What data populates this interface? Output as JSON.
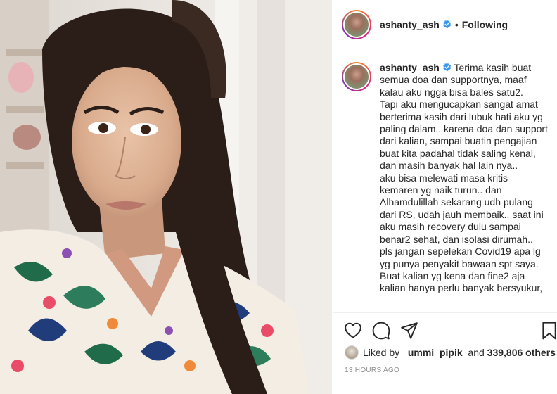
{
  "post": {
    "username": "ashanty_ash",
    "separator": "•",
    "follow_status": "Following",
    "caption_username": "ashanty_ash",
    "caption": " Terima kasih buat semua doa dan supportnya, maaf kalau aku ngga bisa bales satu2.\nTapi aku mengucapkan sangat amat berterima kasih dari lubuk hati aku yg paling dalam.. karena doa dan support dari kalian, sampai buatin pengajian buat kita padahal tidak saling kenal, dan masih banyak hal lain nya..\naku bisa melewati masa kritis kemaren yg naik turun.. dan Alhamdulillah sekarang udh pulang dari RS, udah jauh membaik.. saat ini aku masih recovery dulu sampai benar2 sehat, dan isolasi dirumah..\npls jangan sepelekan Covid19 apa lg yg punya penyakit bawaan spt saya.\nBuat kalian yg kena dan fine2 aja kalian hanya perlu banyak bersyukur,",
    "likes": {
      "prefix": "Liked by ",
      "liker": "_ummi_pipik_",
      "middle": " and ",
      "others": "339,806 others"
    },
    "timestamp": "13 HOURS AGO"
  },
  "icons": {
    "like": "heart-icon",
    "comment": "comment-icon",
    "share": "share-icon",
    "save": "bookmark-icon",
    "verified": "verified-badge-icon"
  },
  "colors": {
    "verified": "#3897f0",
    "text": "#262626",
    "muted": "#8e8e8e",
    "border": "#efefef"
  }
}
